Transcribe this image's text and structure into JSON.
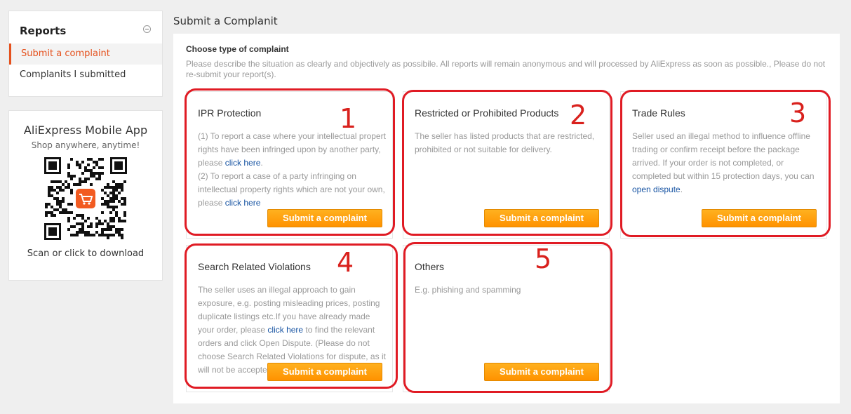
{
  "sidebar": {
    "title": "Reports",
    "items": [
      {
        "label": "Submit a complaint"
      },
      {
        "label": "Complanits I submitted"
      }
    ]
  },
  "app_promo": {
    "title": "AliExpress Mobile App",
    "subtitle": "Shop anywhere, anytime!",
    "scan": "Scan or click to download"
  },
  "page": {
    "title": "Submit a Complanit",
    "choose": "Choose type of complaint",
    "description": "Please describe the situation as clearly and objectively as possibile. All reports will remain anonymous and will processed by AliExpress as soon as possible., Please do not re-submit your report(s)."
  },
  "cards": [
    {
      "title": "IPR Protection",
      "number": "1",
      "p1a": "(1) To report a case where your intellectual propert rights have been infringed upon by another party, please ",
      "p1link": "click here",
      "p1b": ".",
      "p2a": "(2) To report a case of a party infringing on intellectual property rights which are not your own, please ",
      "p2link": "click here",
      "button": "Submit a complaint"
    },
    {
      "title": "Restricted or Prohibited Products",
      "number": "2",
      "text": "The seller has listed products that are restricted, prohibited or not suitable for delivery.",
      "button": "Submit a complaint"
    },
    {
      "title": "Trade Rules",
      "number": "3",
      "text": "Seller used an illegal method to influence offline trading or confirm receipt before the package arrived. If your order is not completed, or completed but within 15 protection days, you can ",
      "link": "open dispute",
      "text_end": ".",
      "button": "Submit a complaint"
    },
    {
      "title": "Search Related Violations",
      "number": "4",
      "text": "The seller uses an illegal approach to gain exposure, e.g. posting misleading prices, posting duplicate listings etc.If you have already made your order, please ",
      "link": "click here",
      "text_end": " to find the relevant orders and click Open Dispute. (Please do not choose Search Related Violations for dispute, as it will not be accepted.)",
      "button": "Submit a complaint"
    },
    {
      "title": "Others",
      "number": "5",
      "text": "E.g. phishing and spamming",
      "button": "Submit a complaint"
    }
  ],
  "colors": {
    "accent": "#e5511d",
    "button": "#ff9a00",
    "annotation": "#e01b24",
    "link": "#1a56a4"
  }
}
